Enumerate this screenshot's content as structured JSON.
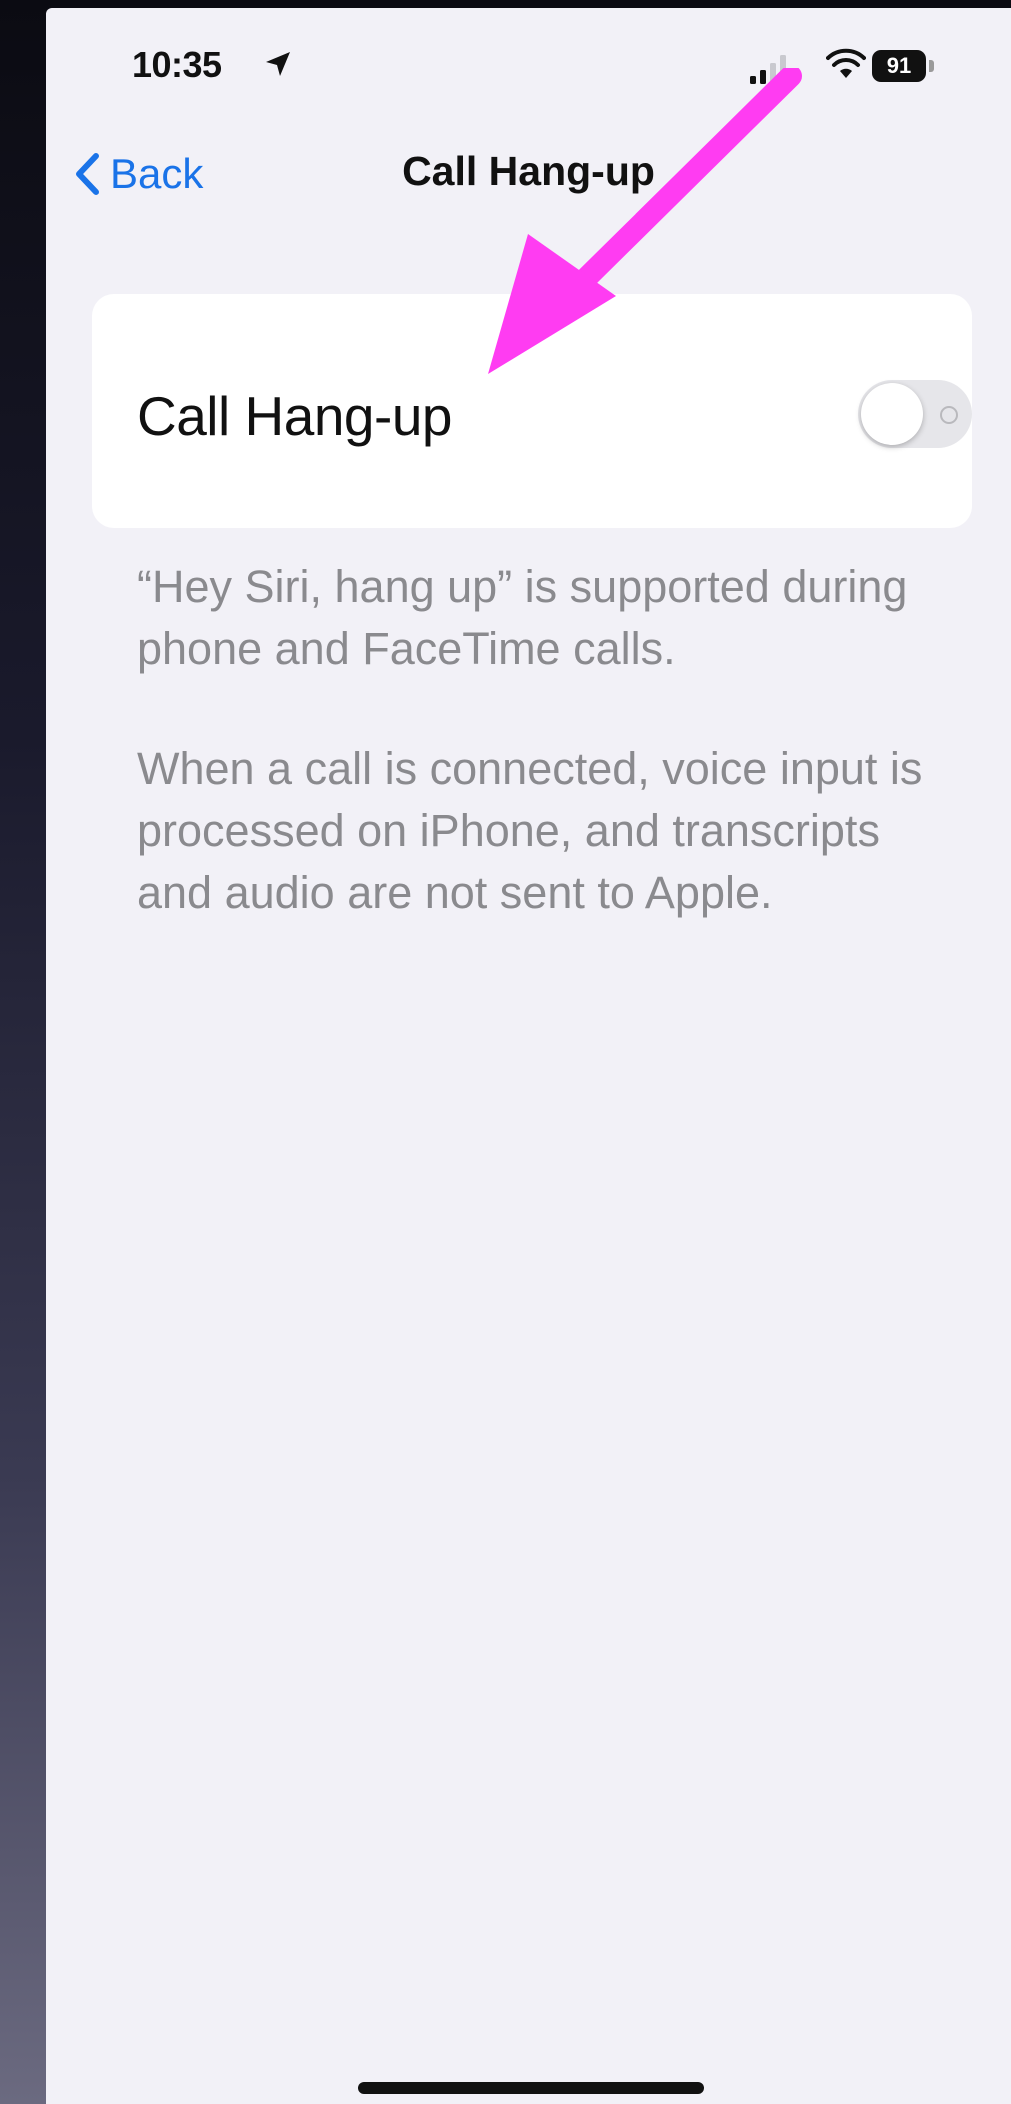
{
  "status_bar": {
    "time": "10:35",
    "battery": "91"
  },
  "nav": {
    "back_label": "Back",
    "title": "Call Hang-up"
  },
  "setting": {
    "label": "Call Hang-up",
    "enabled": false
  },
  "notes": [
    "“Hey Siri, hang up” is supported during phone and FaceTime calls.",
    "When a call is connected, voice input is processed on iPhone, and transcripts and audio are not sent to Apple."
  ],
  "colors": {
    "accent": "#1a73e8",
    "annotation_arrow": "#ff3cf2",
    "background": "#f2f1f7"
  }
}
